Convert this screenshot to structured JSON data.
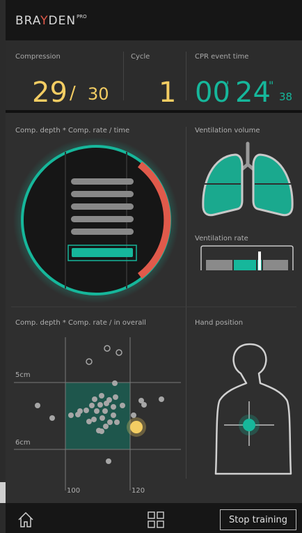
{
  "brand": {
    "name_part1": "BRA",
    "name_accent": "Y",
    "name_part2": "DEN",
    "badge": "PRO"
  },
  "stats": {
    "compression": {
      "label": "Compression",
      "count": "29",
      "slash": "/",
      "target": "30"
    },
    "cycle": {
      "label": "Cycle",
      "value": "1"
    },
    "event_time": {
      "label": "CPR event time",
      "minutes": "00",
      "min_mark": "'",
      "seconds": "24",
      "sec_mark": "\"",
      "centis": "38"
    }
  },
  "depth_rate_time": {
    "label": "Comp. depth * Comp. rate   / time",
    "active_bars": 1,
    "total_bars": 6,
    "rate_arc_fraction": 0.5
  },
  "ventilation_volume": {
    "label": "Ventilation volume"
  },
  "ventilation_rate": {
    "label": "Ventilation rate"
  },
  "overall": {
    "label": "Comp. depth * Comp. rate   / in overall",
    "depth_5cm": "5cm",
    "depth_6cm": "6cm",
    "rate_low": "100",
    "rate_high": "120"
  },
  "hand_position": {
    "label": "Hand position"
  },
  "controls": {
    "stop_label": "Stop training",
    "home_icon": "home-icon",
    "grid_icon": "grid-icon"
  },
  "colors": {
    "teal": "#16b79b",
    "yellow": "#f3cd63",
    "red": "#e05a4b",
    "background": "#2f2f2f"
  }
}
